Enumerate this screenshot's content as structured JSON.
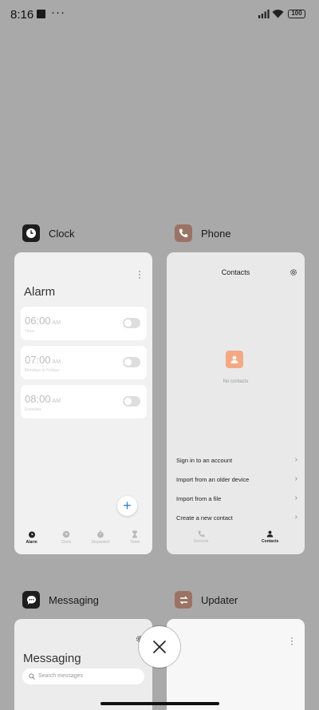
{
  "status_bar": {
    "time": "8:16",
    "dots": "···",
    "battery": "100"
  },
  "colors": {
    "background": "#a9a9a9",
    "fab_plus": "#2f7fe0",
    "contact_avatar": "#f4a983",
    "phone_icon": "#9b7364",
    "updater_icon": "#9b7364"
  },
  "apps": [
    {
      "name": "Clock",
      "icon": "clock-icon",
      "screen": {
        "title": "Alarm",
        "alarms": [
          {
            "time": "06:00",
            "ampm": "AM",
            "sub": "Once"
          },
          {
            "time": "07:00",
            "ampm": "AM",
            "sub": "Mondays to Fridays"
          },
          {
            "time": "08:00",
            "ampm": "AM",
            "sub": "Everyday"
          }
        ],
        "fab": "+",
        "nav": [
          {
            "label": "Alarm",
            "icon": "alarm-icon",
            "active": true
          },
          {
            "label": "Clock",
            "icon": "clock-face-icon",
            "active": false
          },
          {
            "label": "Stopwatch",
            "icon": "stopwatch-icon",
            "active": false
          },
          {
            "label": "Timer",
            "icon": "hourglass-icon",
            "active": false
          }
        ]
      }
    },
    {
      "name": "Phone",
      "icon": "phone-icon",
      "screen": {
        "title": "Contacts",
        "empty": "No contacts",
        "options": [
          "Sign in to an account",
          "Import from an older device",
          "Import from a file",
          "Create a new contact"
        ],
        "nav": [
          {
            "label": "Recents",
            "icon": "phone-recents-icon",
            "active": false
          },
          {
            "label": "Contacts",
            "icon": "person-icon",
            "active": true
          }
        ]
      }
    },
    {
      "name": "Messaging",
      "icon": "message-icon",
      "screen": {
        "title": "Messaging",
        "search_placeholder": "Search messages"
      }
    },
    {
      "name": "Updater",
      "icon": "updater-icon"
    }
  ]
}
